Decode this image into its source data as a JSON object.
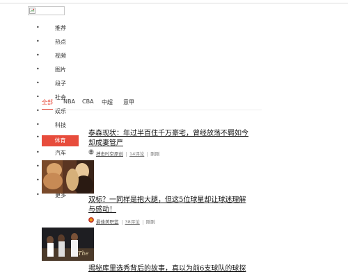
{
  "nav": {
    "items": [
      {
        "label": "推荐"
      },
      {
        "label": "热点"
      },
      {
        "label": "视频"
      },
      {
        "label": "图片"
      },
      {
        "label": "段子"
      },
      {
        "label": "社会"
      },
      {
        "label": "娱乐"
      },
      {
        "label": "科技"
      },
      {
        "label": "体育"
      },
      {
        "label": "汽车"
      },
      {
        "label": "更多"
      }
    ]
  },
  "subtabs": [
    "全部",
    "NBA",
    "CBA",
    "中超",
    "意甲"
  ],
  "articles": [
    {
      "title": "泰森现状：年过半百住千万豪宅，曾经放荡不羁如今却成妻管严",
      "source": "搏击时空原创",
      "comments": "14评论",
      "time": "刚刚"
    },
    {
      "title": "双标？一同样是抱大腿，但这5位球星却让球迷理解与感动！",
      "source": "最佳美职篮",
      "comments": "38评论",
      "time": "刚刚"
    },
    {
      "title": "揭秘库里选秀背后的故事，真以为前6支球队的球探"
    }
  ]
}
